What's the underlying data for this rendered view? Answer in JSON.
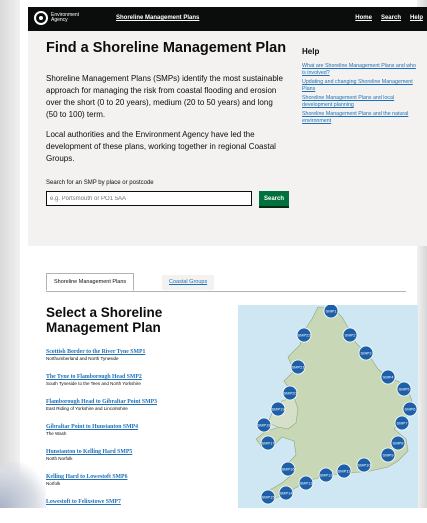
{
  "header": {
    "logo_text": "Environment Agency",
    "site_title": "Shoreline Management Plans",
    "nav": [
      "Home",
      "Search",
      "Help"
    ]
  },
  "main": {
    "title": "Find a Shoreline Management Plan",
    "intro": "Shoreline Management Plans (SMPs) identify the most sustainable approach for managing the risk from coastal flooding and erosion over the short (0 to 20 years), medium (20 to 50 years) and long (50 to 100) term.",
    "intro2": "Local authorities and the Environment Agency have led the development of these plans, working together in regional Coastal Groups.",
    "search": {
      "label": "Search for an SMP by place or postcode",
      "placeholder": "e.g. Portsmouth or PO1 5AA",
      "button": "Search"
    }
  },
  "help": {
    "title": "Help",
    "links": [
      "What are Shoreline Management Plans and who is involved?",
      "Updating and changing Shoreline Management Plans",
      "Shoreline Management Plans and local development planning",
      "Shoreline Management Plans and the natural environment"
    ]
  },
  "tabs": [
    "Shoreline Management Plans",
    "Coastal Groups"
  ],
  "select": {
    "title": "Select a Shoreline Management Plan",
    "plans": [
      {
        "name": "Scottish Border to the River Tyne SMP1",
        "area": "Northumberland and North Tyneside"
      },
      {
        "name": "The Tyne to Flamborough Head SMP2",
        "area": "South Tyneside to the Tees and North Yorkshire"
      },
      {
        "name": "Flamborough Head to Gibraltar Point SMP3",
        "area": "East Riding of Yorkshire and Lincolnshire"
      },
      {
        "name": "Gibraltar Point to Hunstanton SMP4",
        "area": "The Wash"
      },
      {
        "name": "Hunstanton to Kelling Hard SMP5",
        "area": "North Norfolk"
      },
      {
        "name": "Kelling Hard to Lowestoft SMP6",
        "area": "Norfolk"
      },
      {
        "name": "Lowestoft to Felixstowe SMP7",
        "area": ""
      }
    ]
  },
  "map": {
    "markers": [
      "SMP1",
      "SMP2",
      "SMP3",
      "SMP4",
      "SMP5",
      "SMP6",
      "SMP7",
      "SMP8",
      "SMP9",
      "SMP10",
      "SMP11",
      "SMP12",
      "SMP13",
      "SMP14",
      "SMP15",
      "SMP16",
      "SMP17",
      "SMP18",
      "SMP19",
      "SMP20",
      "SMP21",
      "SMP22"
    ]
  },
  "colors": {
    "header": "#0b0c0c",
    "link": "#1d70b8",
    "button": "#00703c",
    "panel": "#f3f2f1",
    "marker": "#1d5fa8",
    "sea": "#cfe6f3"
  }
}
